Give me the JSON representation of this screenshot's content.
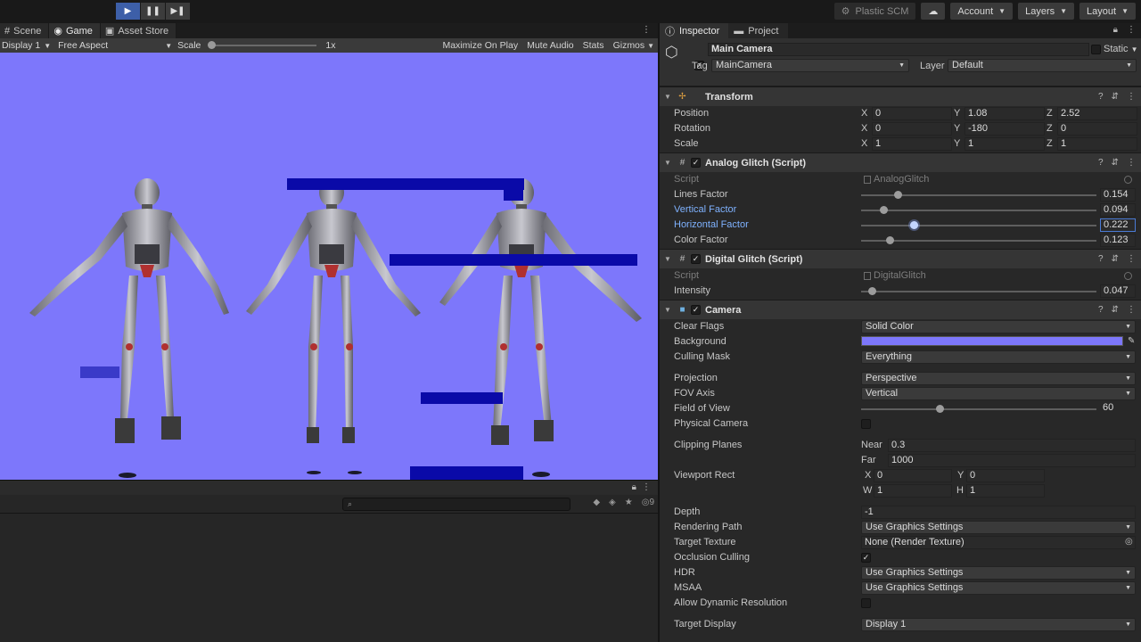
{
  "toolbar": {
    "plastic": "Plastic SCM",
    "account": "Account",
    "layers": "Layers",
    "layout": "Layout"
  },
  "scene_tabs": {
    "scene": "Scene",
    "game": "Game",
    "asset_store": "Asset Store"
  },
  "gamebar": {
    "display": "Display 1",
    "aspect": "Free Aspect",
    "scale_label": "Scale",
    "scale_value": "1x",
    "maximize": "Maximize On Play",
    "mute": "Mute Audio",
    "stats": "Stats",
    "gizmos": "Gizmos"
  },
  "console": {
    "count": "9"
  },
  "inspector": {
    "tabs": {
      "inspector": "Inspector",
      "project": "Project"
    },
    "object": {
      "name": "Main Camera",
      "static": "Static",
      "tag_label": "Tag",
      "tag": "MainCamera",
      "layer_label": "Layer",
      "layer": "Default"
    },
    "transform": {
      "title": "Transform",
      "position_label": "Position",
      "rotation_label": "Rotation",
      "scale_label": "Scale",
      "axis_x": "X",
      "axis_y": "Y",
      "axis_z": "Z",
      "position": {
        "x": "0",
        "y": "1.08",
        "z": "2.52"
      },
      "rotation": {
        "x": "0",
        "y": "-180",
        "z": "0"
      },
      "scale": {
        "x": "1",
        "y": "1",
        "z": "1"
      }
    },
    "analog": {
      "title": "Analog Glitch (Script)",
      "script_label": "Script",
      "script": "AnalogGlitch",
      "lines_label": "Lines Factor",
      "lines": "0.154",
      "vertical_label": "Vertical Factor",
      "vertical": "0.094",
      "horizontal_label": "Horizontal Factor",
      "horizontal": "0.222",
      "color_label": "Color Factor",
      "color": "0.123"
    },
    "digital": {
      "title": "Digital Glitch (Script)",
      "script_label": "Script",
      "script": "DigitalGlitch",
      "intensity_label": "Intensity",
      "intensity": "0.047"
    },
    "camera": {
      "title": "Camera",
      "clear_flags_label": "Clear Flags",
      "clear_flags": "Solid Color",
      "background_label": "Background",
      "culling_label": "Culling Mask",
      "culling": "Everything",
      "projection_label": "Projection",
      "projection": "Perspective",
      "fov_axis_label": "FOV Axis",
      "fov_axis": "Vertical",
      "fov_label": "Field of View",
      "fov": "60",
      "physical_label": "Physical Camera",
      "clipping_label": "Clipping Planes",
      "near_label": "Near",
      "near": "0.3",
      "far_label": "Far",
      "far": "1000",
      "viewport_label": "Viewport Rect",
      "vr_x_label": "X",
      "vr_x": "0",
      "vr_y_label": "Y",
      "vr_y": "0",
      "vr_w_label": "W",
      "vr_w": "1",
      "vr_h_label": "H",
      "vr_h": "1",
      "depth_label": "Depth",
      "depth": "-1",
      "rendering_label": "Rendering Path",
      "rendering": "Use Graphics Settings",
      "target_texture_label": "Target Texture",
      "target_texture": "None (Render Texture)",
      "occlusion_label": "Occlusion Culling",
      "hdr_label": "HDR",
      "hdr": "Use Graphics Settings",
      "msaa_label": "MSAA",
      "msaa": "Use Graphics Settings",
      "dynres_label": "Allow Dynamic Resolution",
      "target_display_label": "Target Display",
      "target_display": "Display 1"
    }
  },
  "slider_fractions": {
    "lines": 0.154,
    "vertical": 0.094,
    "horizontal": 0.222,
    "color": 0.123,
    "intensity": 0.047,
    "fov": 0.333
  },
  "colors": {
    "game_background": "#7d77fb",
    "glitch_block": "#0a0aa8",
    "accent": "#3d5fa8"
  }
}
